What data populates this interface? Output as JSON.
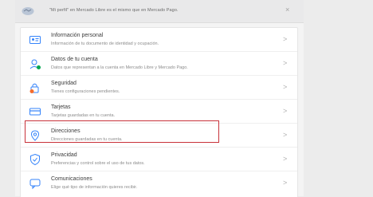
{
  "banner": {
    "icon": "mercadolibre-handshake-icon",
    "text": "\"Mi perfil\" en Mercado Libre es el mismo que en Mercado Pago.",
    "close": "×"
  },
  "menu": {
    "items": [
      {
        "icon": "id-card-icon",
        "title": "Información personal",
        "desc": "Información de tu documento de identidad y ocupación."
      },
      {
        "icon": "account-data-icon",
        "title": "Datos de tu cuenta",
        "desc": "Datos que representan a la cuenta en Mercado Libre y Mercado Pago."
      },
      {
        "icon": "lock-icon",
        "title": "Seguridad",
        "desc": "Tienes configuraciones pendientes."
      },
      {
        "icon": "credit-card-icon",
        "title": "Tarjetas",
        "desc": "Tarjetas guardadas en tu cuenta."
      },
      {
        "icon": "location-pin-icon",
        "title": "Direcciones",
        "desc": "Direcciones guardadas en tu cuenta."
      },
      {
        "icon": "shield-icon",
        "title": "Privacidad",
        "desc": "Preferencias y control sobre el uso de tus datos."
      },
      {
        "icon": "chat-bubble-icon",
        "title": "Comunicaciones",
        "desc": "Elige qué tipo de información quieres recibir."
      }
    ],
    "chevron": ">"
  },
  "colors": {
    "highlight": "#c8323a",
    "icon_blue": "#3483fa",
    "alert_orange": "#f56c2d",
    "ok_green": "#00a650"
  }
}
